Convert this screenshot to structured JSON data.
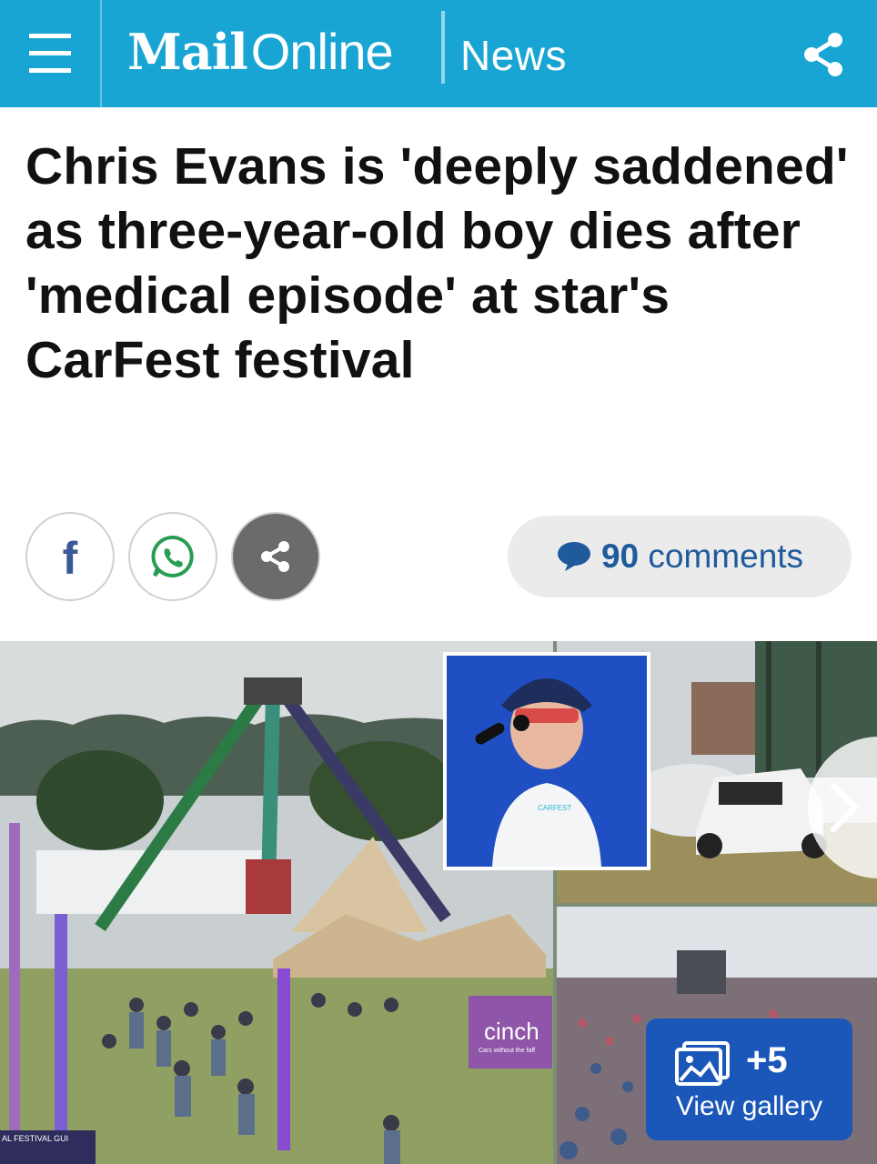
{
  "header": {
    "logo_mail": "Mail",
    "logo_online": "Online",
    "section": "News",
    "brand_color": "#18a5d3"
  },
  "article": {
    "headline": "Chris Evans is 'deeply saddened' as three-year-old boy dies after 'medical episode' at star's CarFest festival"
  },
  "share": {
    "facebook_glyph": "f",
    "icons": [
      "facebook-icon",
      "whatsapp-icon",
      "share-icon"
    ]
  },
  "comments": {
    "count": "90",
    "label": "comments",
    "icon": "comment-bubble-icon"
  },
  "gallery": {
    "more_count": "+5",
    "view_label": "View gallery",
    "sign_cinch": "cinch",
    "sign_cinch_tagline": "Cars without the faff",
    "sign_festival_guide": "AL FESTIVAL GUI",
    "sign_carfest_shirt": "CARFEST"
  }
}
